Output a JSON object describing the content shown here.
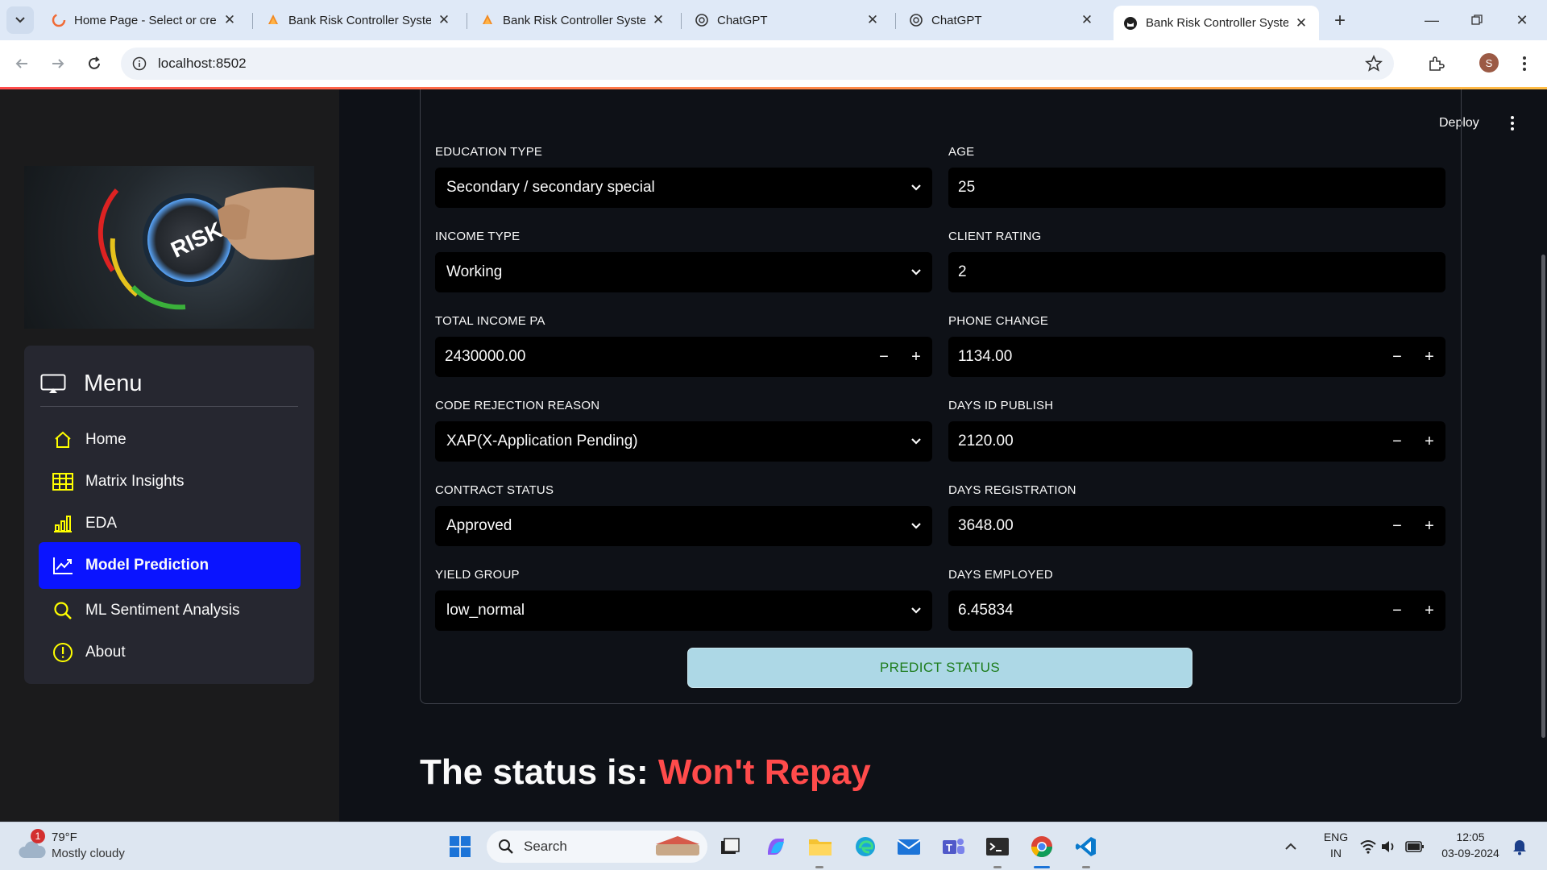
{
  "browser": {
    "tabs": [
      {
        "title": "Home Page - Select or create",
        "icon": "loading-spinner-icon",
        "active": false
      },
      {
        "title": "Bank Risk Controller System",
        "icon": "streamlit-icon",
        "active": false
      },
      {
        "title": "Bank Risk Controller System",
        "icon": "streamlit-icon",
        "active": false
      },
      {
        "title": "ChatGPT",
        "icon": "chatgpt-icon",
        "active": false
      },
      {
        "title": "ChatGPT",
        "icon": "chatgpt-icon",
        "active": false
      },
      {
        "title": "Bank Risk Controller System",
        "icon": "github-icon",
        "active": true
      }
    ],
    "url": "localhost:8502",
    "profile_initial": "S"
  },
  "sidebar": {
    "menu_title": "Menu",
    "items": [
      {
        "label": "Home",
        "icon": "house-icon"
      },
      {
        "label": "Matrix Insights",
        "icon": "table-icon"
      },
      {
        "label": "EDA",
        "icon": "bar-chart-icon"
      },
      {
        "label": "Model Prediction",
        "icon": "graph-up-icon",
        "selected": true
      },
      {
        "label": "ML Sentiment Analysis",
        "icon": "search-icon"
      },
      {
        "label": "About",
        "icon": "exclamation-circle-icon"
      }
    ],
    "hero_text": "RISK"
  },
  "header": {
    "deploy_label": "Deploy"
  },
  "form": {
    "education_type": {
      "label": "EDUCATION TYPE",
      "value": "Secondary / secondary special"
    },
    "age": {
      "label": "AGE",
      "value": "25"
    },
    "income_type": {
      "label": "INCOME TYPE",
      "value": "Working"
    },
    "client_rating": {
      "label": "CLIENT RATING",
      "value": "2"
    },
    "total_income": {
      "label": "TOTAL INCOME PA",
      "value": "2430000.00"
    },
    "phone_change": {
      "label": "PHONE CHANGE",
      "value": "1134.00"
    },
    "code_rejection": {
      "label": "CODE REJECTION REASON",
      "value": "XAP(X-Application Pending)"
    },
    "days_id_publish": {
      "label": "DAYS ID PUBLISH",
      "value": "2120.00"
    },
    "contract_status": {
      "label": "CONTRACT STATUS",
      "value": "Approved"
    },
    "days_registration": {
      "label": "DAYS REGISTRATION",
      "value": "3648.00"
    },
    "yield_group": {
      "label": "YIELD GROUP",
      "value": "low_normal"
    },
    "days_employed": {
      "label": "DAYS EMPLOYED",
      "value": "6.45834"
    },
    "stepper_minus": "−",
    "stepper_plus": "+",
    "predict_label": "PREDICT STATUS"
  },
  "result": {
    "prefix": "The status is:",
    "value": "Won't Repay"
  },
  "taskbar": {
    "weather_temp": "79°F",
    "weather_cond": "Mostly cloudy",
    "weather_badge": "1",
    "search_label": "Search",
    "lang_1": "ENG",
    "lang_2": "IN",
    "time": "12:05",
    "date": "03-09-2024"
  },
  "colors": {
    "accent_selected": "#0a14ff",
    "status_value": "#ff4b4b",
    "predict_button": "#add8e6",
    "predict_text": "#1e7d1e"
  }
}
